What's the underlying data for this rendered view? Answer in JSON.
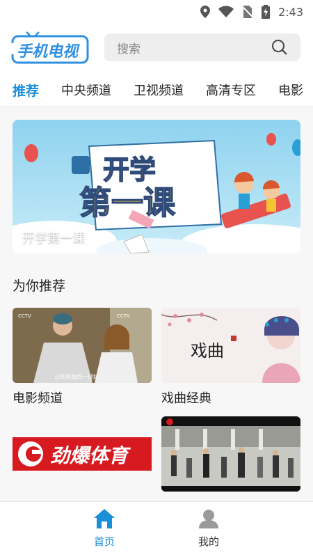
{
  "status": {
    "time": "2:43"
  },
  "header": {
    "logo_text": "手机电视",
    "search_placeholder": "搜索"
  },
  "tabs": [
    {
      "label": "推荐"
    },
    {
      "label": "中央频道"
    },
    {
      "label": "卫视频道"
    },
    {
      "label": "高清专区"
    },
    {
      "label": "电影"
    }
  ],
  "banner": {
    "title_line1": "开学",
    "title_line2": "第一课",
    "caption": "开学第一课"
  },
  "section": {
    "title": "为你推荐"
  },
  "cards": [
    {
      "label": "电影频道",
      "thumb_text": "让你热血的一部好"
    },
    {
      "label": "戏曲经典",
      "thumb_text": "戏曲"
    },
    {
      "label": "",
      "thumb_text": "劲爆体育"
    },
    {
      "label": "",
      "thumb_text": ""
    }
  ],
  "bottom_nav": {
    "home": "首页",
    "me": "我的"
  },
  "colors": {
    "accent": "#1a8ed8",
    "logo": "#2f8fe0",
    "sports_red": "#d71920"
  }
}
